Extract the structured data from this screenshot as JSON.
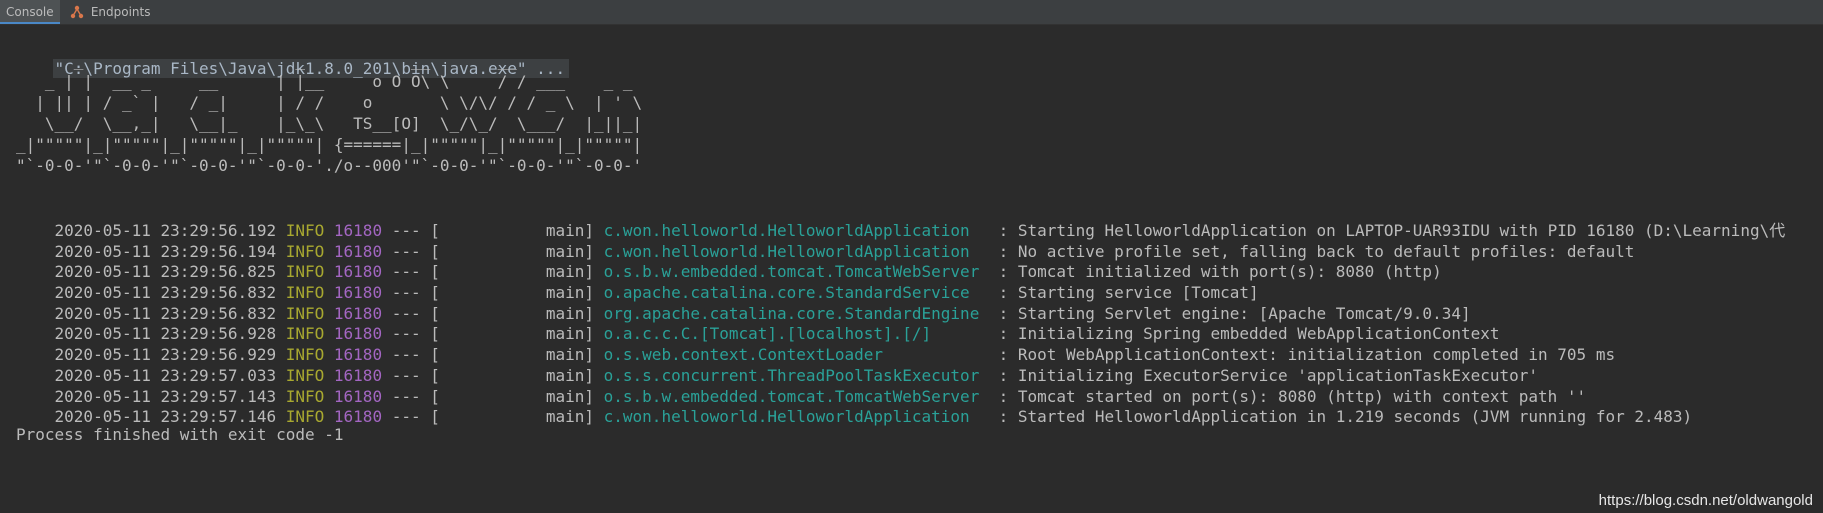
{
  "tabs": [
    {
      "label": "Console",
      "active": true
    },
    {
      "label": "Endpoints",
      "active": false
    }
  ],
  "console": {
    "command": "\"C:\\Program Files\\Java\\jdk1.8.0_201\\bin\\java.exe\" ...",
    "banner": [
      "      _                      _           __       __",
      "   _ | |  __ _     __      | |__     o O O\\ \\     / / ___    _ _",
      "  | || | / _` |   / _|     | / /    o       \\ \\/\\/ / / _ \\  | ' \\",
      "   \\__/  \\__,_|   \\__|_    |_\\_\\   TS__[O]  \\_/\\_/  \\___/  |_||_|",
      "_|\"\"\"\"\"|_|\"\"\"\"\"|_|\"\"\"\"\"|_|\"\"\"\"\"| {======|_|\"\"\"\"\"|_|\"\"\"\"\"|_|\"\"\"\"\"|",
      "\"`-0-0-'\"`-0-0-'\"`-0-0-'\"`-0-0-'./o--000'\"`-0-0-'\"`-0-0-'\"`-0-0-'"
    ],
    "logs": [
      {
        "ts": "2020-05-11 23:29:56.192",
        "level": " INFO",
        "pid": "16180",
        "thread": " --- [           main] ",
        "logger": "c.won.helloworld.HelloworldApplication  ",
        "message": " : Starting HelloworldApplication on LAPTOP-UAR93IDU with PID 16180 (D:\\Learning\\代"
      },
      {
        "ts": "2020-05-11 23:29:56.194",
        "level": " INFO",
        "pid": "16180",
        "thread": " --- [           main] ",
        "logger": "c.won.helloworld.HelloworldApplication  ",
        "message": " : No active profile set, falling back to default profiles: default"
      },
      {
        "ts": "2020-05-11 23:29:56.825",
        "level": " INFO",
        "pid": "16180",
        "thread": " --- [           main] ",
        "logger": "o.s.b.w.embedded.tomcat.TomcatWebServer ",
        "message": " : Tomcat initialized with port(s): 8080 (http)"
      },
      {
        "ts": "2020-05-11 23:29:56.832",
        "level": " INFO",
        "pid": "16180",
        "thread": " --- [           main] ",
        "logger": "o.apache.catalina.core.StandardService  ",
        "message": " : Starting service [Tomcat]"
      },
      {
        "ts": "2020-05-11 23:29:56.832",
        "level": " INFO",
        "pid": "16180",
        "thread": " --- [           main] ",
        "logger": "org.apache.catalina.core.StandardEngine ",
        "message": " : Starting Servlet engine: [Apache Tomcat/9.0.34]"
      },
      {
        "ts": "2020-05-11 23:29:56.928",
        "level": " INFO",
        "pid": "16180",
        "thread": " --- [           main] ",
        "logger": "o.a.c.c.C.[Tomcat].[localhost].[/]      ",
        "message": " : Initializing Spring embedded WebApplicationContext"
      },
      {
        "ts": "2020-05-11 23:29:56.929",
        "level": " INFO",
        "pid": "16180",
        "thread": " --- [           main] ",
        "logger": "o.s.web.context.ContextLoader           ",
        "message": " : Root WebApplicationContext: initialization completed in 705 ms"
      },
      {
        "ts": "2020-05-11 23:29:57.033",
        "level": " INFO",
        "pid": "16180",
        "thread": " --- [           main] ",
        "logger": "o.s.s.concurrent.ThreadPoolTaskExecutor ",
        "message": " : Initializing ExecutorService 'applicationTaskExecutor'"
      },
      {
        "ts": "2020-05-11 23:29:57.143",
        "level": " INFO",
        "pid": "16180",
        "thread": " --- [           main] ",
        "logger": "o.s.b.w.embedded.tomcat.TomcatWebServer ",
        "message": " : Tomcat started on port(s): 8080 (http) with context path ''"
      },
      {
        "ts": "2020-05-11 23:29:57.146",
        "level": " INFO",
        "pid": "16180",
        "thread": " --- [           main] ",
        "logger": "c.won.helloworld.HelloworldApplication  ",
        "message": " : Started HelloworldApplication in 1.219 seconds (JVM running for 2.483)"
      }
    ],
    "exit_message": "Process finished with exit code -1"
  },
  "watermark": "https://blog.csdn.net/oldwangold",
  "colors": {
    "background": "#2b2b2b",
    "info_level": "#a8a830",
    "pid": "#a366c2",
    "logger": "#2aa198"
  }
}
